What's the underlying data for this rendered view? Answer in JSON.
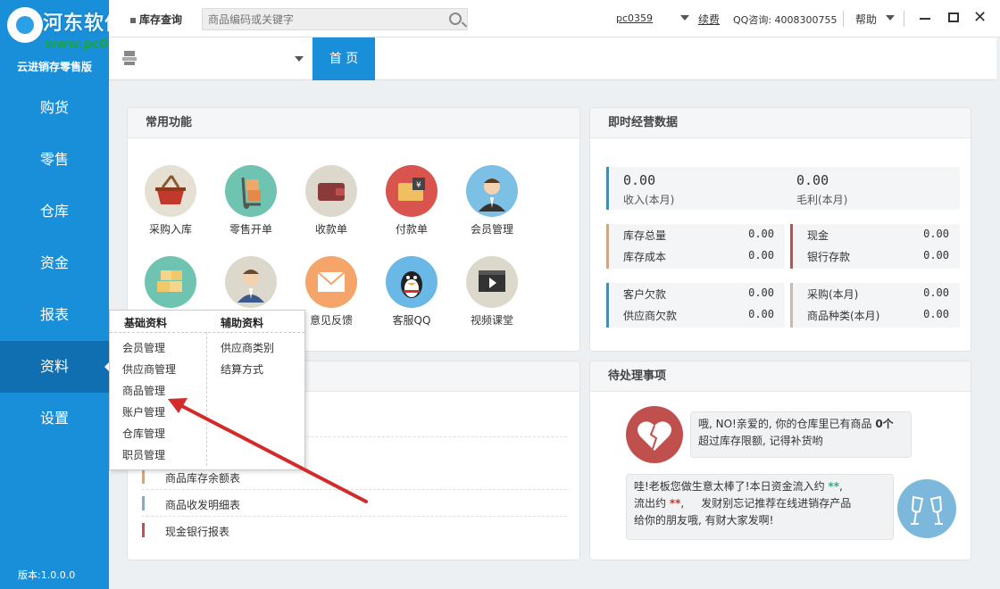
{
  "sidebar": {
    "watermark_site": "河东软件园",
    "watermark_url": "www.pc0359.cn",
    "app_name": "云进销存零售版",
    "items": [
      {
        "label": "购货"
      },
      {
        "label": "零售"
      },
      {
        "label": "仓库"
      },
      {
        "label": "资金"
      },
      {
        "label": "报表"
      },
      {
        "label": "资料"
      },
      {
        "label": "设置"
      }
    ],
    "active_index": 5,
    "version": "版本:1.0.0.0"
  },
  "topbar": {
    "inventory_label": "库存查询",
    "search_placeholder": "商品编码或关键字",
    "user": "pc0359",
    "renew": "续费",
    "qq": "QQ咨询: 4008300755",
    "help": "帮助"
  },
  "tabs": {
    "home": "首 页"
  },
  "common_functions": {
    "title": "常用功能",
    "items": [
      {
        "label": "采购入库",
        "icon": "shopping-basket-icon",
        "color": "#e6e0d4"
      },
      {
        "label": "零售开单",
        "icon": "hand-truck-icon",
        "color": "#6ec4b0"
      },
      {
        "label": "收款单",
        "icon": "wallet-icon",
        "color": "#ddd8cc"
      },
      {
        "label": "付款单",
        "icon": "payment-wallet-icon",
        "color": "#d9534f"
      },
      {
        "label": "会员管理",
        "icon": "member-avatar-icon",
        "color": "#7cc0e6"
      },
      {
        "label": "",
        "icon": "boxes-icon",
        "color": "#6ec4b0"
      },
      {
        "label": "",
        "icon": "staff-avatar-icon",
        "color": "#ddd8cc"
      },
      {
        "label": "意见反馈",
        "icon": "envelope-icon",
        "color": "#f5a56a"
      },
      {
        "label": "客服QQ",
        "icon": "qq-penguin-icon",
        "color": "#6ab8e6"
      },
      {
        "label": "视频课堂",
        "icon": "video-icon",
        "color": "#ddd8cc"
      }
    ]
  },
  "instant_data": {
    "title": "即时经营数据",
    "income_value": "0.00",
    "income_label": "收入(本月)",
    "profit_value": "0.00",
    "profit_label": "毛利(本月)",
    "cells": [
      {
        "label": "库存总量",
        "value": "0.00",
        "color": "#e8a060"
      },
      {
        "label": "库存成本",
        "value": "0.00",
        "color": "#e8a060"
      },
      {
        "label": "现金",
        "value": "0.00",
        "color": "#c0504d"
      },
      {
        "label": "银行存款",
        "value": "0.00",
        "color": "#c0504d"
      },
      {
        "label": "客户欠款",
        "value": "0.00",
        "color": "#1a9bd4"
      },
      {
        "label": "供应商欠款",
        "value": "0.00",
        "color": "#1a9bd4"
      },
      {
        "label": "采购(本月)",
        "value": "0.00",
        "color": "#c8bca8"
      },
      {
        "label": "商品种类(本月)",
        "value": "0.00",
        "color": "#c8bca8"
      }
    ]
  },
  "popup": {
    "basic_header": "基础资料",
    "aux_header": "辅助资料",
    "basic_items": [
      "会员管理",
      "供应商管理",
      "商品管理",
      "账户管理",
      "仓库管理",
      "职员管理"
    ],
    "aux_items": [
      "供应商类别",
      "结算方式"
    ]
  },
  "reports": {
    "rows": [
      {
        "label": "商品库存余额表",
        "color": "#e8a060"
      },
      {
        "label": "商品收发明细表",
        "color": "#7ab0c8"
      },
      {
        "label": "现金银行报表",
        "color": "#c0504d"
      }
    ]
  },
  "pending": {
    "title": "待处理事项",
    "msg1_line1_pre": "哦, NO!亲爱的, 你的仓库里已有商品",
    "msg1_count": "0个",
    "msg1_line2": "超过库存限额, 记得补货哟",
    "msg2_line1_pre": "哇!老板您做生意太棒了!本日资金流入约",
    "msg2_in": "**",
    "msg2_line2_pre": "流出约",
    "msg2_out": "**",
    "msg2_line2_post": "发财别忘记推荐在线进销存产品",
    "msg2_line3": "给你的朋友哦, 有财大家发啊!"
  }
}
